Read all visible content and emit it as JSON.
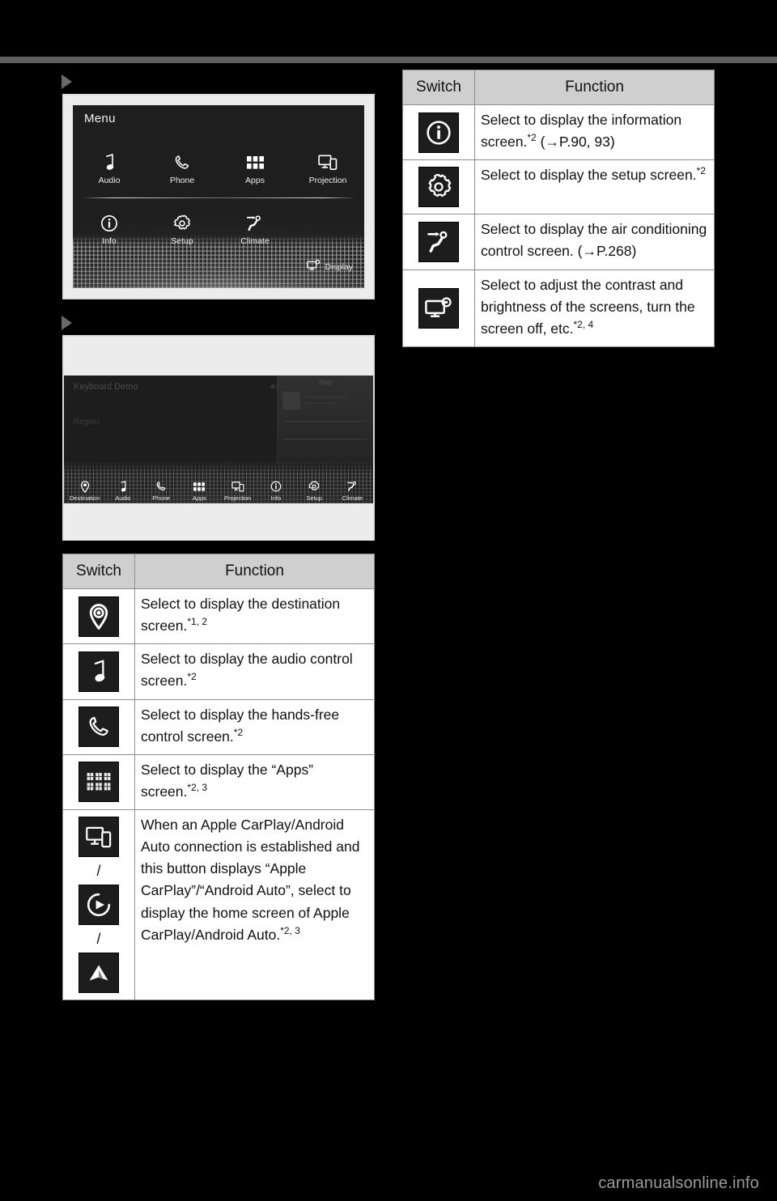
{
  "page": {
    "background_color": "#000000",
    "rule_color": "#5e5e5e",
    "watermark": "carmanualsonline.info"
  },
  "figures": {
    "menu_screen": {
      "title": "Menu",
      "row1": [
        {
          "label": "Audio",
          "icon": "music-note-icon"
        },
        {
          "label": "Phone",
          "icon": "phone-handset-icon"
        },
        {
          "label": "Apps",
          "icon": "apps-grid-icon"
        },
        {
          "label": "Projection",
          "icon": "projection-icon"
        }
      ],
      "row2": [
        {
          "label": "Info",
          "icon": "info-circle-icon"
        },
        {
          "label": "Setup",
          "icon": "gear-icon"
        },
        {
          "label": "Climate",
          "icon": "climate-seat-icon"
        }
      ],
      "display_button": {
        "label": "Display",
        "icon": "display-settings-icon"
      }
    },
    "nav_screen": {
      "ghost_title": "Keyboard Demo",
      "ghost_sub": "Region",
      "status": "all",
      "map_card_label": "Map",
      "bottom_bar": [
        {
          "label": "Destination",
          "icon": "map-pin-icon"
        },
        {
          "label": "Audio",
          "icon": "music-note-icon"
        },
        {
          "label": "Phone",
          "icon": "phone-handset-icon"
        },
        {
          "label": "Apps",
          "icon": "apps-grid-icon"
        },
        {
          "label": "Projection",
          "icon": "projection-icon"
        },
        {
          "label": "Info",
          "icon": "info-circle-icon"
        },
        {
          "label": "Setup",
          "icon": "gear-icon"
        },
        {
          "label": "Climate",
          "icon": "climate-seat-icon"
        }
      ]
    }
  },
  "table_left": {
    "headers": {
      "switch": "Switch",
      "function": "Function"
    },
    "rows": [
      {
        "icon": "map-pin-icon",
        "text": "Select to display the destination screen.",
        "note": "*1, 2"
      },
      {
        "icon": "music-note-icon",
        "text": "Select to display the audio control screen.",
        "note": "*2"
      },
      {
        "icon": "phone-handset-icon",
        "text": "Select to display the hands-free control screen.",
        "note": "*2"
      },
      {
        "icon": "apps-grid-icon",
        "text": "Select to display the “Apps” screen.",
        "note": "*2, 3"
      },
      {
        "icons": [
          "projection-icon",
          "apple-carplay-icon",
          "android-auto-icon"
        ],
        "separator": "/",
        "text": "When an Apple CarPlay/Android Auto connection is established and this button displays “Apple CarPlay”/“Android Auto”, select to display the home screen of Apple CarPlay/Android Auto.",
        "note": "*2, 3"
      }
    ]
  },
  "table_right": {
    "headers": {
      "switch": "Switch",
      "function": "Function"
    },
    "rows": [
      {
        "icon": "info-circle-icon",
        "text": "Select to display the information screen.",
        "note": "*2",
        "ref": "(→P.90, 93)"
      },
      {
        "icon": "gear-icon",
        "text": "Select to display the setup screen.",
        "note": "*2",
        "ref": ""
      },
      {
        "icon": "climate-seat-icon",
        "text": "Select to display the air conditioning control screen.",
        "note": "",
        "ref": "(→P.268)"
      },
      {
        "icon": "display-settings-icon",
        "text": "Select to adjust the contrast and brightness of the screens, turn the screen off, etc.",
        "note": "*2, 4",
        "ref": ""
      }
    ]
  }
}
